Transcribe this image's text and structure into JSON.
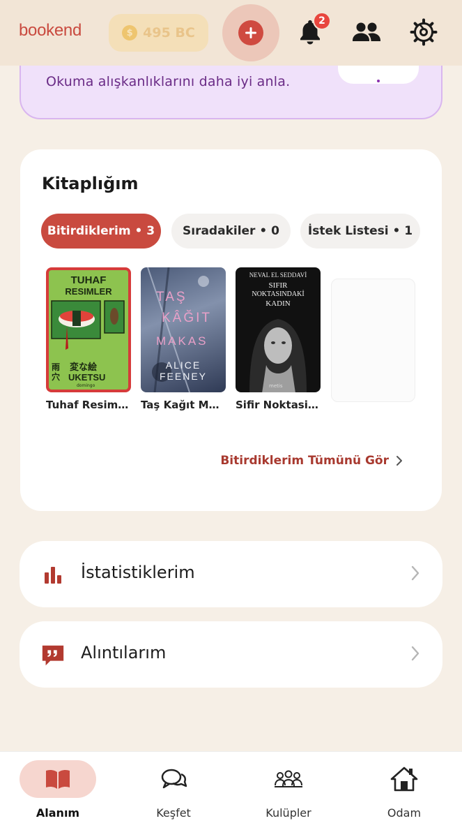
{
  "app": {
    "logo": "bookend"
  },
  "header": {
    "coins_label": "495 BC",
    "coin_symbol": "$",
    "notification_count": "2",
    "icons": [
      "coin-icon",
      "plus-icon",
      "bell-icon",
      "friends-icon",
      "gear-icon"
    ]
  },
  "promo": {
    "text": "Okuma alışkanlıklarını daha iyi anla."
  },
  "library": {
    "title": "Kitaplığım",
    "chips": [
      {
        "label": "Bitirdiklerim • 3",
        "active": true
      },
      {
        "label": "Sıradakiler • 0",
        "active": false
      },
      {
        "label": "İstek Listesi • 1",
        "active": false
      }
    ],
    "books": [
      {
        "title": "Tuhaf Resimler",
        "cover": {
          "line1": "TUHAF",
          "line2": "RESIMLER",
          "kanji": "変な絵",
          "author": "UKETSU",
          "side": "雨穴",
          "publisher": "domingo"
        }
      },
      {
        "title": "Taş Kağıt Ma...",
        "cover": {
          "line1": "TAŞ",
          "line2": "KÂĞIT",
          "line3": "MAKAS",
          "author": "ALICE FEENEY"
        }
      },
      {
        "title": "Sifir Noktasin...",
        "cover": {
          "author": "NEVAL EL SEDDAVİ",
          "line1": "SIFIR",
          "line2": "NOKTASINDAKİ",
          "line3": "KADIN",
          "publisher": "metis"
        }
      }
    ],
    "see_all": "Bitirdiklerim Tümünü Gör"
  },
  "menu": [
    {
      "label": "İstatistiklerim",
      "icon": "bar-chart-icon"
    },
    {
      "label": "Alıntılarım",
      "icon": "quote-icon"
    }
  ],
  "nav": [
    {
      "label": "Alanım",
      "icon": "book-open-icon",
      "active": true
    },
    {
      "label": "Keşfet",
      "icon": "chat-bubbles-icon",
      "active": false
    },
    {
      "label": "Kulüpler",
      "icon": "group-icon",
      "active": false
    },
    {
      "label": "Odam",
      "icon": "home-icon",
      "active": false
    }
  ],
  "colors": {
    "accent": "#c94a3f",
    "background": "#f6efe6",
    "promo_bg": "#f0e1fa",
    "promo_text": "#6a2b86"
  }
}
